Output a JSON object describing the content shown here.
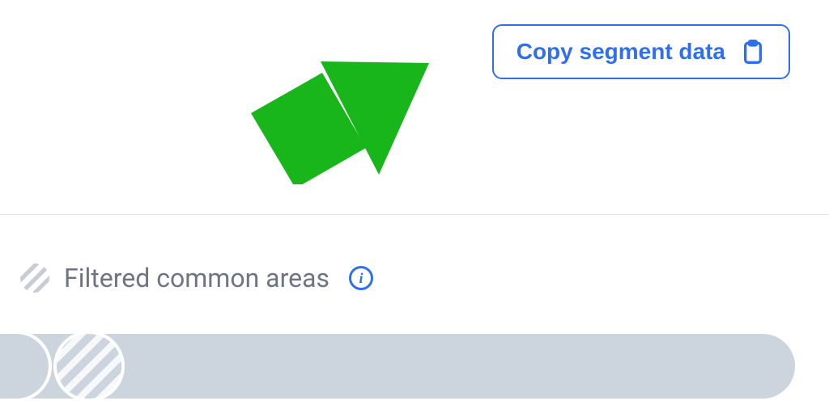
{
  "actions": {
    "copy_segment_label": "Copy segment data"
  },
  "annotation": {
    "arrow_color": "#18b61b"
  },
  "legend": {
    "filtered_label": "Filtered common areas"
  },
  "colors": {
    "primary": "#2f6fed",
    "muted_text": "#6d7580",
    "bar_fill": "#ccd4de"
  }
}
